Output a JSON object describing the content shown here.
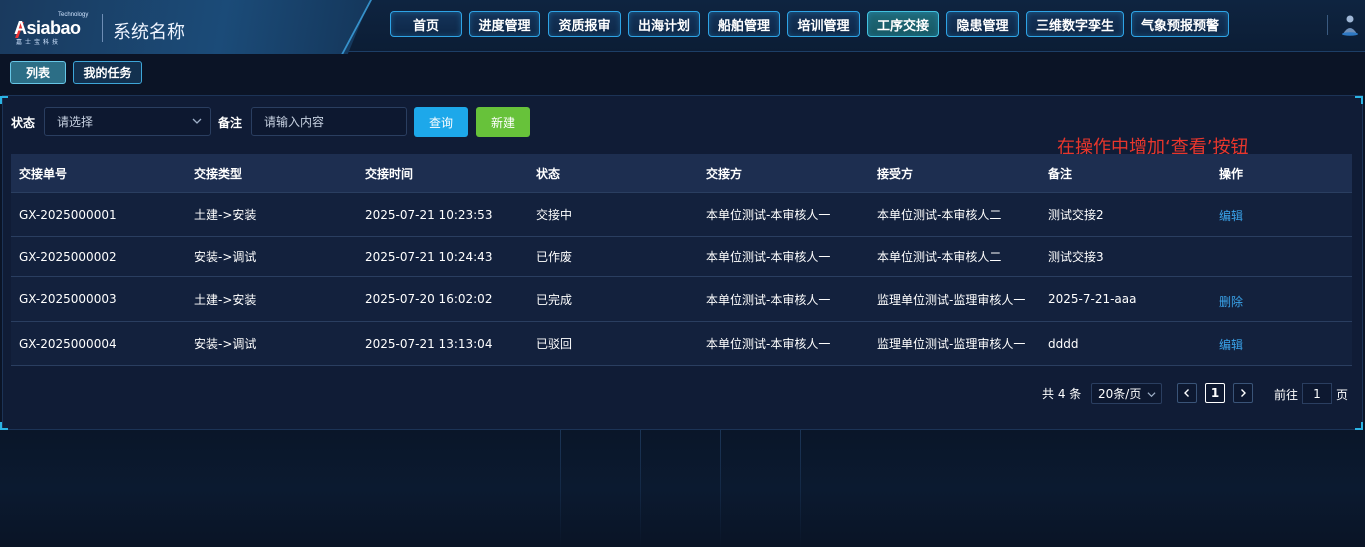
{
  "header": {
    "logo_text": "Asiabao",
    "logo_sup": "Technology",
    "logo_cn": "嘉士宝科技",
    "system_name": "系统名称",
    "nav": [
      {
        "label": "首页",
        "active": false
      },
      {
        "label": "进度管理",
        "active": false
      },
      {
        "label": "资质报审",
        "active": false
      },
      {
        "label": "出海计划",
        "active": false
      },
      {
        "label": "船舶管理",
        "active": false
      },
      {
        "label": "培训管理",
        "active": false
      },
      {
        "label": "工序交接",
        "active": true
      },
      {
        "label": "隐患管理",
        "active": false
      },
      {
        "label": "三维数字孪生",
        "active": false
      },
      {
        "label": "气象预报预警",
        "active": false
      }
    ]
  },
  "subtabs": [
    {
      "label": "列表",
      "active": true
    },
    {
      "label": "我的任务",
      "active": false
    }
  ],
  "filters": {
    "status_label": "状态",
    "status_placeholder": "请选择",
    "remark_label": "备注",
    "remark_placeholder": "请输入内容",
    "query_button": "查询",
    "new_button": "新建"
  },
  "annotation": "在操作中增加‘查看’按钮",
  "table": {
    "headers": [
      "交接单号",
      "交接类型",
      "交接时间",
      "状态",
      "交接方",
      "接受方",
      "备注",
      "操作"
    ],
    "rows": [
      {
        "id": "GX-2025000001",
        "type": "土建->安装",
        "time": "2025-07-21 10:23:53",
        "status": "交接中",
        "from": "本单位测试-本审核人一",
        "to": "本单位测试-本审核人二",
        "remark": "测试交接2",
        "op": "编辑"
      },
      {
        "id": "GX-2025000002",
        "type": "安装->调试",
        "time": "2025-07-21 10:24:43",
        "status": "已作废",
        "from": "本单位测试-本审核人一",
        "to": "本单位测试-本审核人二",
        "remark": "测试交接3",
        "op": ""
      },
      {
        "id": "GX-2025000003",
        "type": "土建->安装",
        "time": "2025-07-20 16:02:02",
        "status": "已完成",
        "from": "本单位测试-本审核人一",
        "to": "监理单位测试-监理审核人一",
        "remark": "2025-7-21-aaa",
        "op": "删除"
      },
      {
        "id": "GX-2025000004",
        "type": "安装->调试",
        "time": "2025-07-21 13:13:04",
        "status": "已驳回",
        "from": "本单位测试-本审核人一",
        "to": "监理单位测试-监理审核人一",
        "remark": "dddd",
        "op": "编辑"
      }
    ]
  },
  "pagination": {
    "total_text": "共 4 条",
    "page_size": "20条/页",
    "current_page": "1",
    "goto_label": "前往",
    "goto_value": "1",
    "page_unit": "页",
    "prev_icon": "chevron-left-icon",
    "next_icon": "chevron-right-icon"
  },
  "colors": {
    "background": "#0b1426",
    "accent": "#2ea4e6",
    "query_button": "#1da8ea",
    "new_button": "#67c23a",
    "link": "#3aa3ea",
    "annotation": "#e8362c"
  }
}
